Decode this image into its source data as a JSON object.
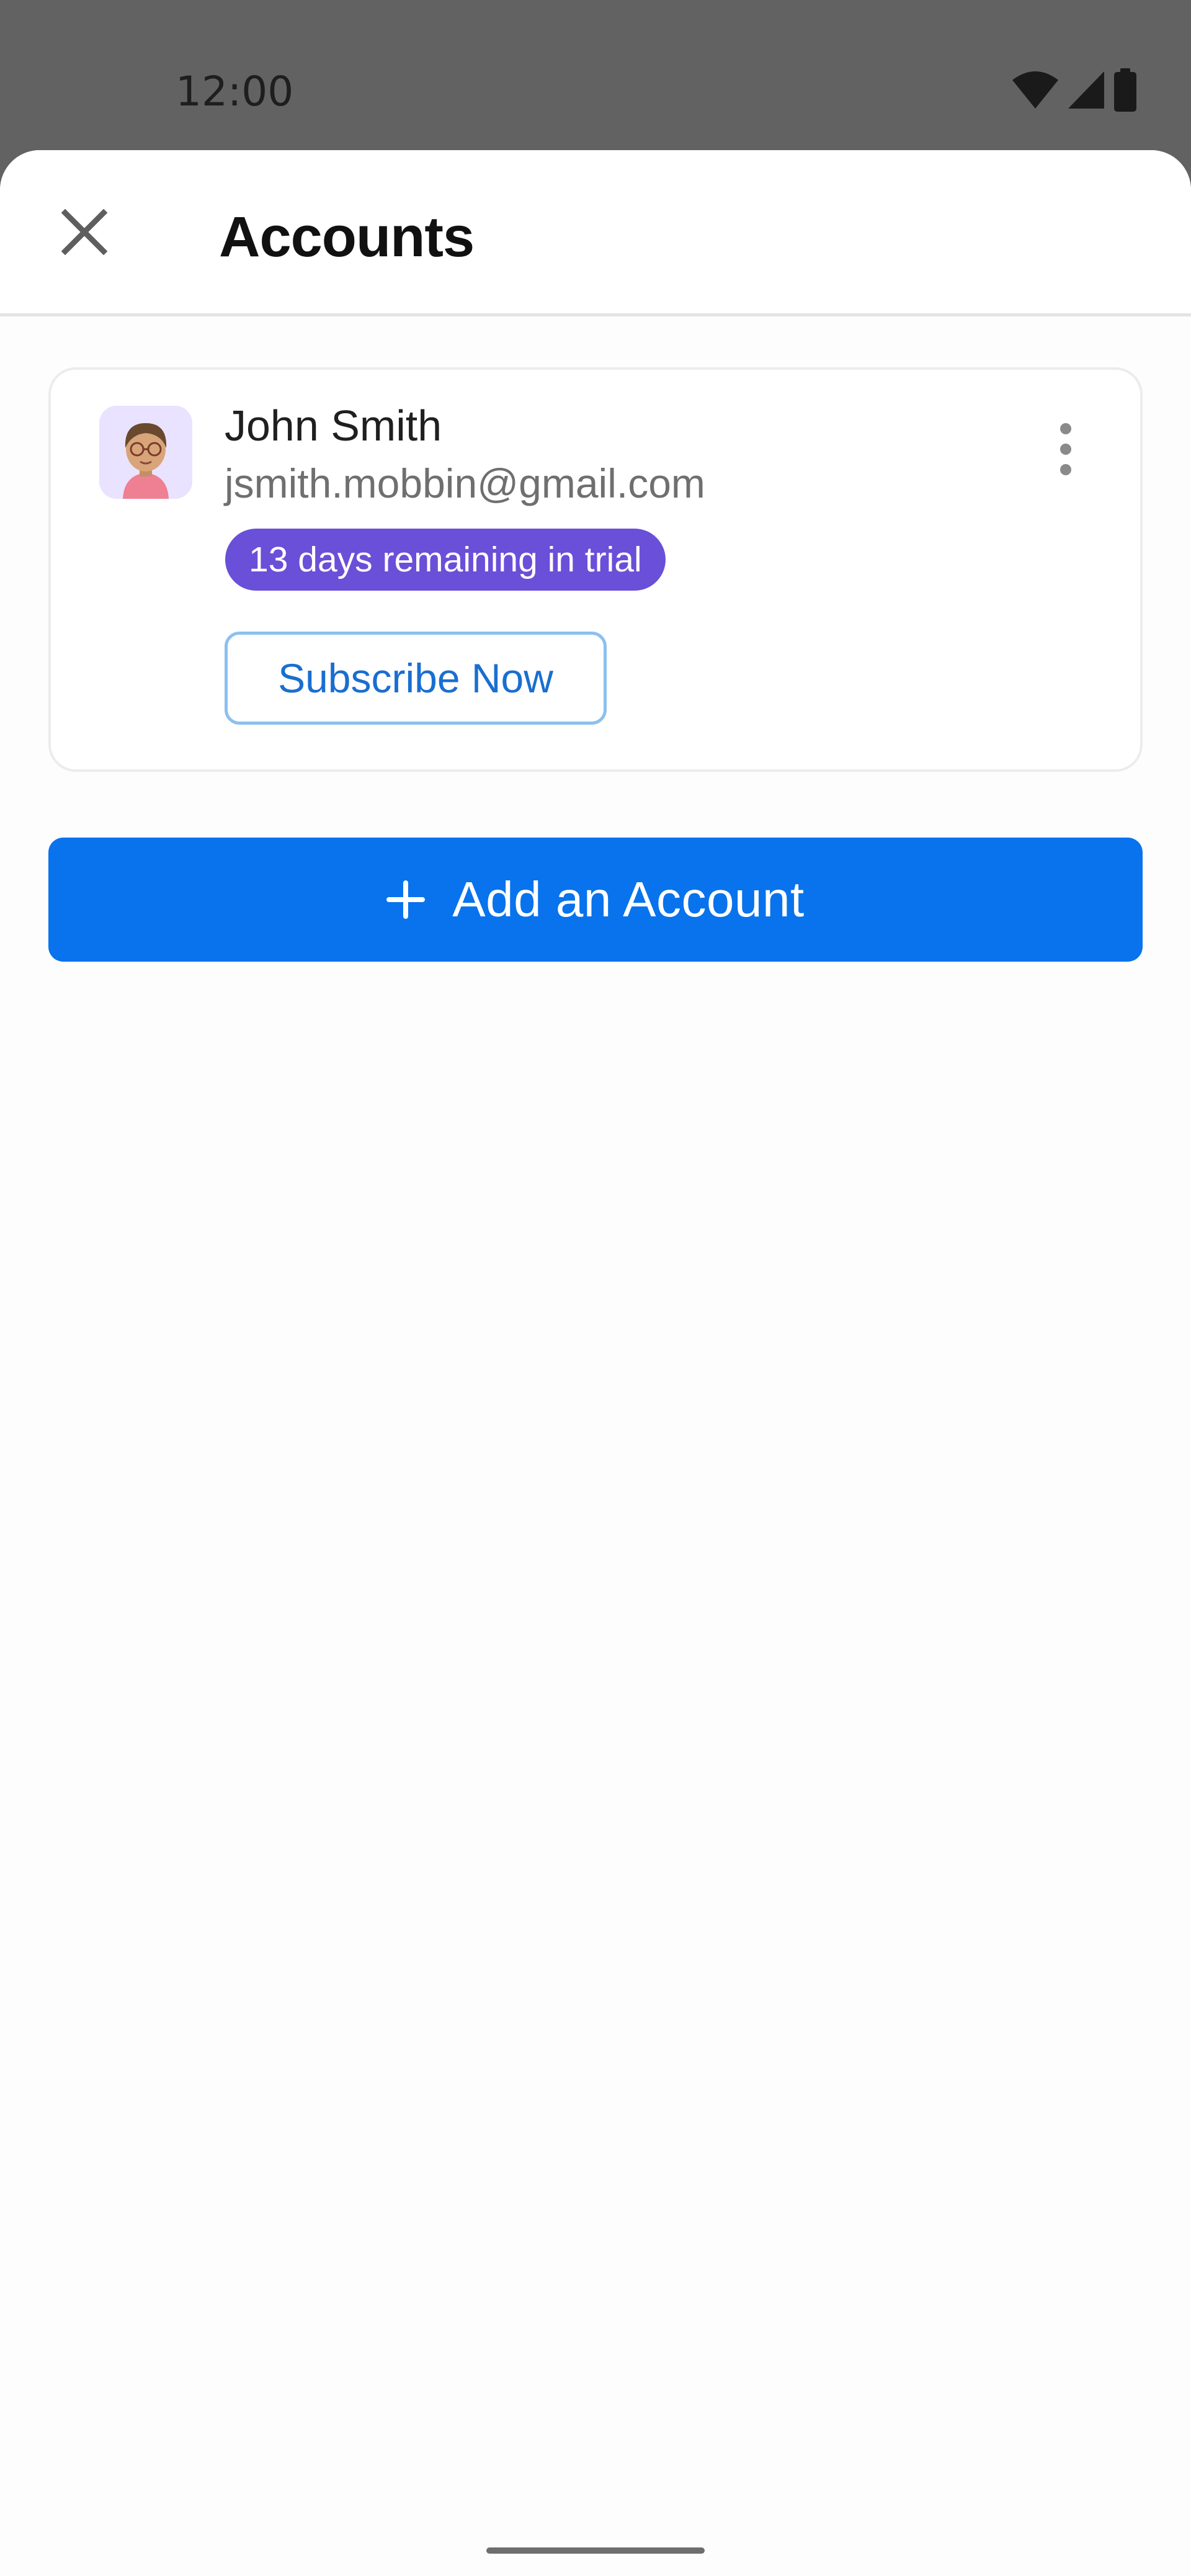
{
  "status_bar": {
    "time": "12:00",
    "icons": [
      "wifi-icon",
      "signal-icon",
      "battery-icon"
    ]
  },
  "header": {
    "title": "Accounts",
    "close_icon": "close-icon"
  },
  "account": {
    "name": "John Smith",
    "email": "jsmith.mobbin@gmail.com",
    "trial_badge": "13 days remaining in trial",
    "subscribe_label": "Subscribe Now",
    "more_icon": "more-vertical-icon",
    "avatar_icon": "avatar"
  },
  "add_account": {
    "label": "Add an Account",
    "icon": "plus-icon"
  },
  "colors": {
    "scrim": "#626262",
    "sheet": "#fdfdfd",
    "primary": "#0873ec",
    "badge": "#6a4fd8",
    "link": "#1a6ed0"
  }
}
